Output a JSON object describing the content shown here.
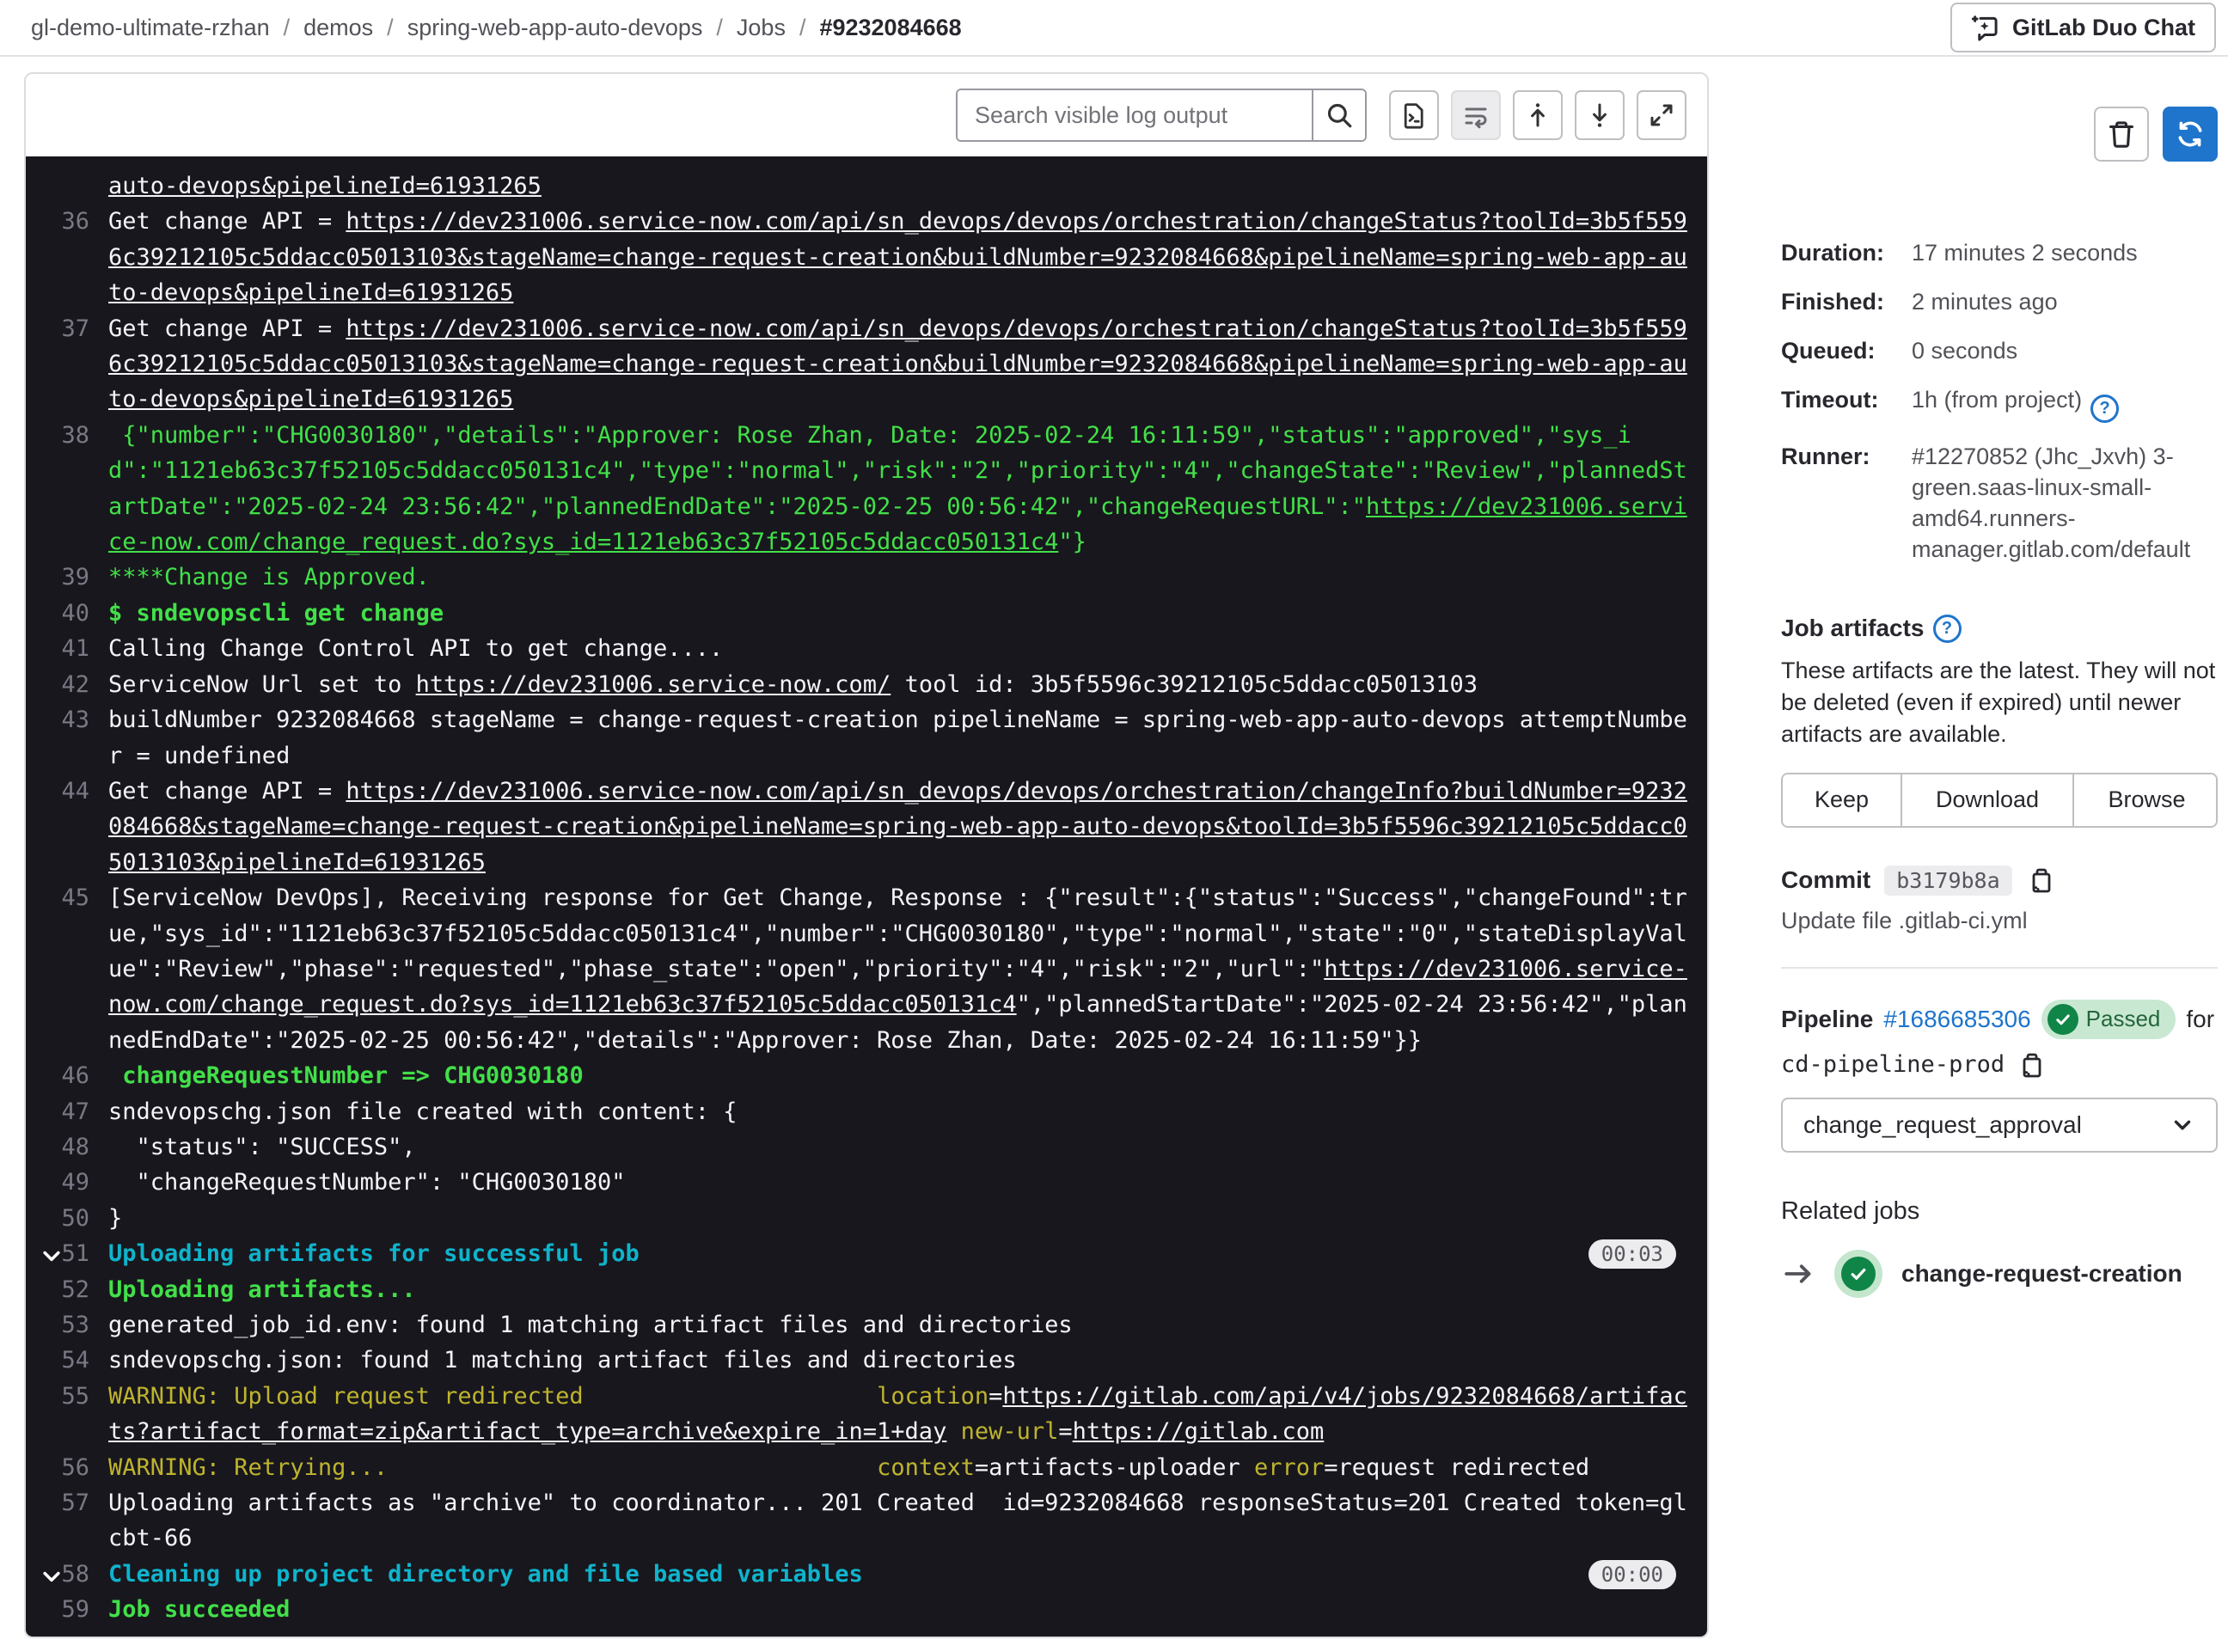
{
  "breadcrumb": {
    "separator": "/",
    "items": [
      "gl-demo-ultimate-rzhan",
      "demos",
      "spring-web-app-auto-devops",
      "Jobs",
      "#9232084668"
    ]
  },
  "duo_chat": {
    "label": "GitLab Duo Chat"
  },
  "toolbar": {
    "search_placeholder": "Search visible log output",
    "buttons": [
      "show-raw-log",
      "wrap-lines",
      "scroll-to-top",
      "scroll-to-bottom",
      "fullscreen"
    ]
  },
  "colors": {
    "accent_blue": "#1f75cb",
    "success_green": "#108548",
    "log_green": "#42e049",
    "log_cyan": "#0fb4cc",
    "log_yellow": "#beb42e",
    "log_bg": "#18171d"
  },
  "log": {
    "lines": [
      {
        "num": "",
        "segs": [
          {
            "t": "auto-devops&pipelineId=61931265",
            "c": "l"
          }
        ]
      },
      {
        "num": "36",
        "segs": [
          {
            "t": "Get change API = ",
            "c": "p"
          },
          {
            "t": "https://dev231006.service-now.com/api/sn_devops/devops/orchestration/changeStatus?toolId=3b5f5596c39212105c5ddacc05013103&stageName=change-request-creation&buildNumber=9232084668&pipelineName=spring-web-app-auto-devops&pipelineId=61931265",
            "c": "l"
          }
        ]
      },
      {
        "num": "37",
        "segs": [
          {
            "t": "Get change API = ",
            "c": "p"
          },
          {
            "t": "https://dev231006.service-now.com/api/sn_devops/devops/orchestration/changeStatus?toolId=3b5f5596c39212105c5ddacc05013103&stageName=change-request-creation&buildNumber=9232084668&pipelineName=spring-web-app-auto-devops&pipelineId=61931265",
            "c": "l"
          }
        ]
      },
      {
        "num": "38",
        "segs": [
          {
            "t": " {\"number\":\"CHG0030180\",\"details\":\"Approver: Rose Zhan, Date: 2025-02-24 16:11:59\",\"status\":\"approved\",\"sys_id\":\"1121eb63c37f52105c5ddacc050131c4\",\"type\":\"normal\",\"risk\":\"2\",\"priority\":\"4\",\"changeState\":\"Review\",\"plannedStartDate\":\"2025-02-24 23:56:42\",\"plannedEndDate\":\"2025-02-25 00:56:42\",\"changeRequestURL\":\"",
            "c": "g"
          },
          {
            "t": "https://dev231006.service-now.com/change_request.do?sys_id=1121eb63c37f52105c5ddacc050131c4",
            "c": "gl"
          },
          {
            "t": "\"}",
            "c": "g"
          }
        ]
      },
      {
        "num": "39",
        "segs": [
          {
            "t": "****Change is Approved.",
            "c": "g"
          }
        ]
      },
      {
        "num": "40",
        "segs": [
          {
            "t": "$ sndevopscli get change",
            "c": "gb"
          }
        ]
      },
      {
        "num": "41",
        "segs": [
          {
            "t": "Calling Change Control API to get change....",
            "c": "p"
          }
        ]
      },
      {
        "num": "42",
        "segs": [
          {
            "t": "ServiceNow Url set to ",
            "c": "p"
          },
          {
            "t": "https://dev231006.service-now.com/",
            "c": "l"
          },
          {
            "t": " tool id: 3b5f5596c39212105c5ddacc05013103",
            "c": "p"
          }
        ]
      },
      {
        "num": "43",
        "segs": [
          {
            "t": "buildNumber 9232084668 stageName = change-request-creation pipelineName = spring-web-app-auto-devops attemptNumber = undefined",
            "c": "p"
          }
        ]
      },
      {
        "num": "44",
        "segs": [
          {
            "t": "Get change API = ",
            "c": "p"
          },
          {
            "t": "https://dev231006.service-now.com/api/sn_devops/devops/orchestration/changeInfo?buildNumber=9232084668&stageName=change-request-creation&pipelineName=spring-web-app-auto-devops&toolId=3b5f5596c39212105c5ddacc05013103&pipelineId=61931265",
            "c": "l"
          }
        ]
      },
      {
        "num": "45",
        "segs": [
          {
            "t": "[ServiceNow DevOps], Receiving response for Get Change, Response : {\"result\":{\"status\":\"Success\",\"changeFound\":true,\"sys_id\":\"1121eb63c37f52105c5ddacc050131c4\",\"number\":\"CHG0030180\",\"type\":\"normal\",\"state\":\"0\",\"stateDisplayValue\":\"Review\",\"phase\":\"requested\",\"phase_state\":\"open\",\"priority\":\"4\",\"risk\":\"2\",\"url\":\"",
            "c": "p"
          },
          {
            "t": "https://dev231006.service-now.com/change_request.do?sys_id=1121eb63c37f52105c5ddacc050131c4",
            "c": "l"
          },
          {
            "t": "\",\"plannedStartDate\":\"2025-02-24 23:56:42\",\"plannedEndDate\":\"2025-02-25 00:56:42\",\"details\":\"Approver: Rose Zhan, Date: 2025-02-24 16:11:59\"}}",
            "c": "p"
          }
        ]
      },
      {
        "num": "46",
        "segs": [
          {
            "t": " changeRequestNumber => CHG0030180",
            "c": "gb"
          }
        ]
      },
      {
        "num": "47",
        "segs": [
          {
            "t": "sndevopschg.json file created with content: {",
            "c": "p"
          }
        ]
      },
      {
        "num": "48",
        "segs": [
          {
            "t": "  \"status\": \"SUCCESS\",",
            "c": "p"
          }
        ]
      },
      {
        "num": "49",
        "segs": [
          {
            "t": "  \"changeRequestNumber\": \"CHG0030180\"",
            "c": "p"
          }
        ]
      },
      {
        "num": "50",
        "segs": [
          {
            "t": "}",
            "c": "p"
          }
        ]
      },
      {
        "num": "51",
        "section": true,
        "badge": "00:03",
        "segs": [
          {
            "t": "Uploading artifacts for successful job",
            "c": "c"
          }
        ]
      },
      {
        "num": "52",
        "segs": [
          {
            "t": "Uploading artifacts...",
            "c": "gb"
          }
        ]
      },
      {
        "num": "53",
        "segs": [
          {
            "t": "generated_job_id.env: found 1 matching artifact files and directories",
            "c": "p"
          }
        ]
      },
      {
        "num": "54",
        "segs": [
          {
            "t": "sndevopschg.json: found 1 matching artifact files and directories",
            "c": "p"
          }
        ]
      },
      {
        "num": "55",
        "segs": [
          {
            "t": "WARNING: Upload request redirected",
            "c": "y"
          },
          {
            "t": "                     ",
            "c": "p"
          },
          {
            "t": "location",
            "c": "y"
          },
          {
            "t": "=",
            "c": "p"
          },
          {
            "t": "https://gitlab.com/api/v4/jobs/9232084668/artifacts?artifact_format=zip&artifact_type=archive&expire_in=1+day",
            "c": "l"
          },
          {
            "t": " ",
            "c": "p"
          },
          {
            "t": "new-url",
            "c": "y"
          },
          {
            "t": "=",
            "c": "p"
          },
          {
            "t": "https://gitlab.com",
            "c": "l"
          }
        ]
      },
      {
        "num": "56",
        "segs": [
          {
            "t": "WARNING: Retrying...",
            "c": "y"
          },
          {
            "t": "                                   ",
            "c": "p"
          },
          {
            "t": "context",
            "c": "y"
          },
          {
            "t": "=artifacts-uploader ",
            "c": "p"
          },
          {
            "t": "error",
            "c": "y"
          },
          {
            "t": "=request redirected",
            "c": "p"
          }
        ]
      },
      {
        "num": "57",
        "segs": [
          {
            "t": "Uploading artifacts as \"archive\" to coordinator... 201 Created  id=9232084668 responseStatus=201 Created token=glcbt-66",
            "c": "p"
          }
        ]
      },
      {
        "num": "58",
        "section": true,
        "badge": "00:00",
        "segs": [
          {
            "t": "Cleaning up project directory and file based variables",
            "c": "c"
          }
        ]
      },
      {
        "num": "59",
        "segs": [
          {
            "t": "Job succeeded",
            "c": "gb"
          }
        ]
      }
    ]
  },
  "sidebar": {
    "details": [
      {
        "label": "Duration:",
        "value": "17 minutes 2 seconds"
      },
      {
        "label": "Finished:",
        "value": "2 minutes ago"
      },
      {
        "label": "Queued:",
        "value": "0 seconds"
      },
      {
        "label": "Timeout:",
        "value": "1h (from project)",
        "help": true
      },
      {
        "label": "Runner:",
        "value": "#12270852 (Jhc_Jxvh) 3-green.saas-linux-small-amd64.runners-manager.gitlab.com/default"
      }
    ],
    "artifacts": {
      "title": "Job artifacts",
      "description": "These artifacts are the latest. They will not be deleted (even if expired) until newer artifacts are available.",
      "buttons": [
        "Keep",
        "Download",
        "Browse"
      ]
    },
    "commit": {
      "label": "Commit",
      "sha": "b3179b8a",
      "message": "Update file .gitlab-ci.yml"
    },
    "pipeline": {
      "label": "Pipeline",
      "id": "#1686685306",
      "status": "Passed",
      "for_text": "for",
      "ref": "cd-pipeline-prod",
      "selected_job": "change_request_approval"
    },
    "related": {
      "title": "Related jobs",
      "jobs": [
        {
          "name": "change-request-creation",
          "status": "success"
        }
      ]
    }
  }
}
